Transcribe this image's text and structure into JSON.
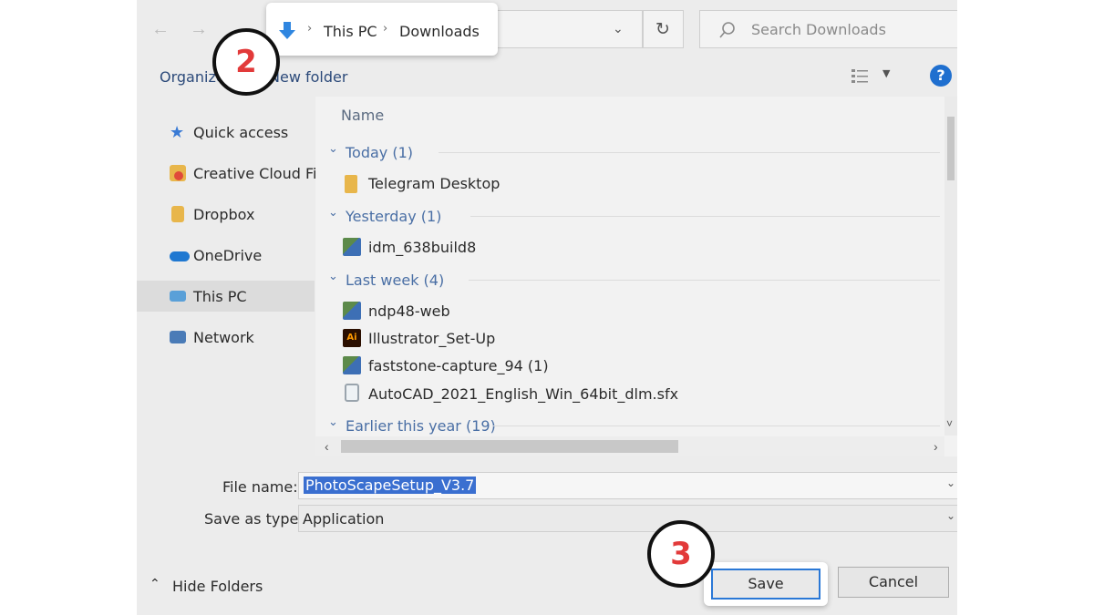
{
  "breadcrumb": {
    "items": [
      "This PC",
      "Downloads"
    ]
  },
  "search": {
    "placeholder": "Search Downloads"
  },
  "toolbar": {
    "organize_label": "Organize",
    "new_folder_label": "New folder"
  },
  "sidebar": {
    "items": [
      {
        "label": "Quick access",
        "icon": "star-icon",
        "color": "#3a7bd5"
      },
      {
        "label": "Creative Cloud Files",
        "icon": "creative-cloud-icon",
        "color": "#e04a3a"
      },
      {
        "label": "Dropbox",
        "icon": "folder-icon",
        "color": "#e8b64b"
      },
      {
        "label": "OneDrive",
        "icon": "cloud-icon",
        "color": "#1f78d1"
      },
      {
        "label": "This PC",
        "icon": "computer-icon",
        "color": "#5aa0d8"
      },
      {
        "label": "Network",
        "icon": "network-icon",
        "color": "#4a7bb7"
      }
    ]
  },
  "file_list": {
    "column_name": "Name",
    "groups": [
      {
        "label": "Today (1)",
        "files": [
          {
            "name": "Telegram Desktop",
            "icon": "folder-icon"
          }
        ]
      },
      {
        "label": "Yesterday (1)",
        "files": [
          {
            "name": "idm_638build8",
            "icon": "installer-icon"
          }
        ]
      },
      {
        "label": "Last week (4)",
        "files": [
          {
            "name": "ndp48-web",
            "icon": "installer-icon"
          },
          {
            "name": "Illustrator_Set-Up",
            "icon": "illustrator-icon",
            "icon_text": "Ai"
          },
          {
            "name": "faststone-capture_94 (1)",
            "icon": "installer-icon"
          },
          {
            "name": "AutoCAD_2021_English_Win_64bit_dlm.sfx",
            "icon": "sfx-icon"
          }
        ]
      },
      {
        "label": "Earlier this year (19)",
        "files": []
      }
    ]
  },
  "form": {
    "file_name_label": "File name:",
    "file_name_value": "PhotoScapeSetup_V3.7",
    "save_type_label": "Save as type:",
    "save_type_value": "Application"
  },
  "footer": {
    "hide_folders_label": "Hide Folders",
    "save_label": "Save",
    "cancel_label": "Cancel"
  },
  "annotations": {
    "badge_2": "2",
    "badge_3": "3",
    "badge_color": "#e23a3a"
  }
}
